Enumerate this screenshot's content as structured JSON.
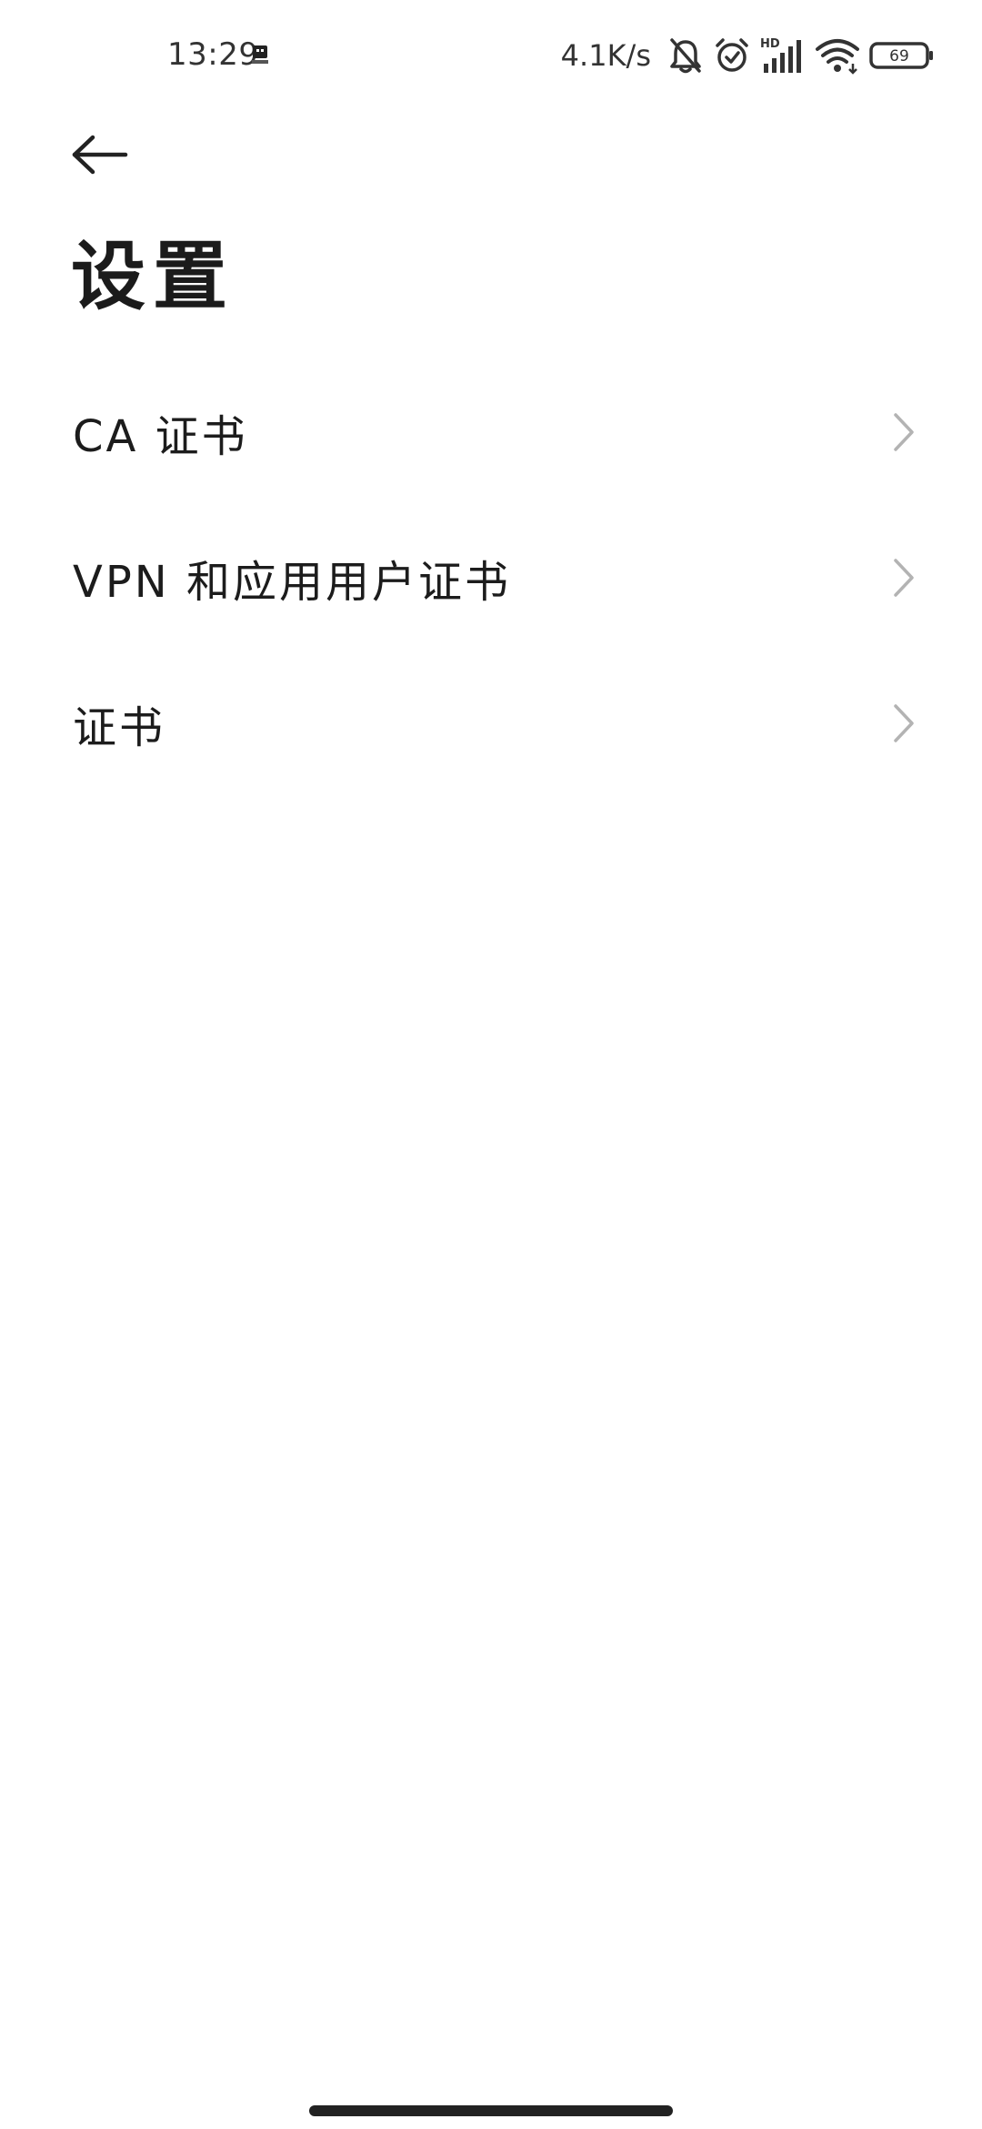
{
  "status_bar": {
    "time": "13:29",
    "net_speed": "4.1K/s",
    "network_badge": "HD",
    "battery": "69",
    "icons": [
      "app-notification-icon",
      "bell-off-icon",
      "alarm-icon",
      "signal-icon",
      "wifi-icon",
      "battery-icon"
    ]
  },
  "header": {
    "back_icon": "arrow-left-icon",
    "title": "设置"
  },
  "list": {
    "items": [
      {
        "label": "CA 证书",
        "icon": "chevron-right-icon"
      },
      {
        "label": "VPN 和应用用户证书",
        "icon": "chevron-right-icon"
      },
      {
        "label": "证书",
        "icon": "chevron-right-icon"
      }
    ]
  },
  "colors": {
    "background": "#ffffff",
    "text": "#1c1c1c",
    "chevron": "#b3b3b3",
    "home_indicator": "#222222"
  }
}
